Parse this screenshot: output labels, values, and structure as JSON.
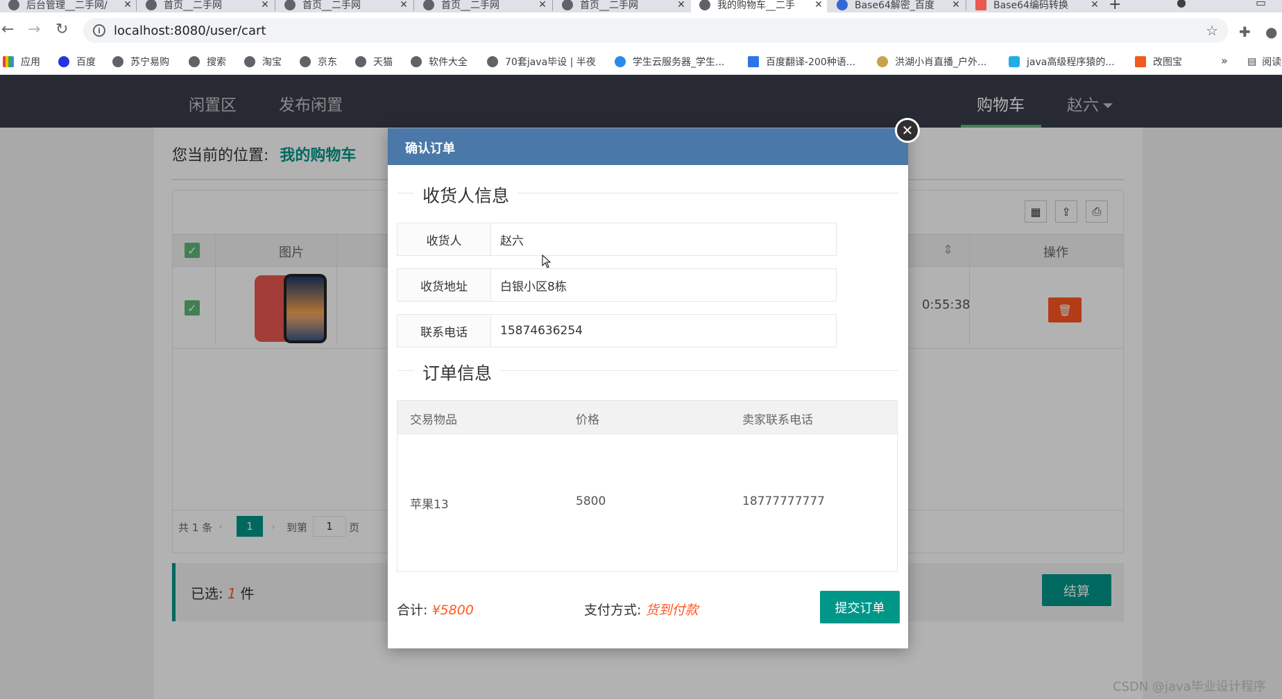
{
  "browser": {
    "tabs": [
      {
        "title": "后台管理__二手网/"
      },
      {
        "title": "首页__二手网"
      },
      {
        "title": "首页__二手网"
      },
      {
        "title": "首页__二手网"
      },
      {
        "title": "首页__二手网"
      },
      {
        "title": "我的购物车__二手"
      },
      {
        "title": "Base64解密_百度"
      },
      {
        "title": "Base64编码转换"
      }
    ],
    "url": "localhost:8080/user/cart",
    "bookmarks": [
      "应用",
      "百度",
      "苏宁易购",
      "搜索",
      "淘宝",
      "京东",
      "天猫",
      "软件大全",
      "70套java毕设 | 半夜",
      "学生云服务器_学生...",
      "百度翻译-200种语...",
      "洪湖小肖直播_户外...",
      "java高级程序猿的...",
      "改图宝"
    ],
    "reading_list": "阅读"
  },
  "site": {
    "nav": {
      "left": [
        "闲置区",
        "发布闲置"
      ],
      "cart": "购物车",
      "user": "赵六"
    },
    "breadcrumb": {
      "label": "您当前的位置:",
      "current": "我的购物车"
    },
    "table": {
      "col_image": "图片",
      "col_ops": "操作",
      "row_time": "0:55:38"
    },
    "pager": {
      "total": "共 1 条",
      "current": "1",
      "goto": "到第",
      "page_input": "1",
      "page_suffix": "页"
    },
    "summary": {
      "selected_prefix": "已选:",
      "selected_count": "1",
      "selected_suffix": "件",
      "checkout": "结算"
    }
  },
  "modal": {
    "title": "确认订单",
    "receiver_section": "收货人信息",
    "fields": [
      {
        "label": "收货人",
        "value": "赵六"
      },
      {
        "label": "收货地址",
        "value": "白银小区8栋"
      },
      {
        "label": "联系电话",
        "value": "15874636254"
      }
    ],
    "order_section": "订单信息",
    "order_table": {
      "headers": [
        "交易物品",
        "价格",
        "卖家联系电话"
      ],
      "rows": [
        [
          "苹果13",
          "5800",
          "18777777777"
        ]
      ]
    },
    "total_label": "合计:",
    "total_value": "¥5800",
    "pay_label": "支付方式:",
    "pay_value": "货到付款",
    "submit": "提交订单"
  },
  "watermark": "CSDN @java毕业设计程序",
  "colors": {
    "primary": "#009688",
    "danger": "#ff5722",
    "modal_header": "#4a78a9",
    "nav_bg": "#393d49"
  }
}
